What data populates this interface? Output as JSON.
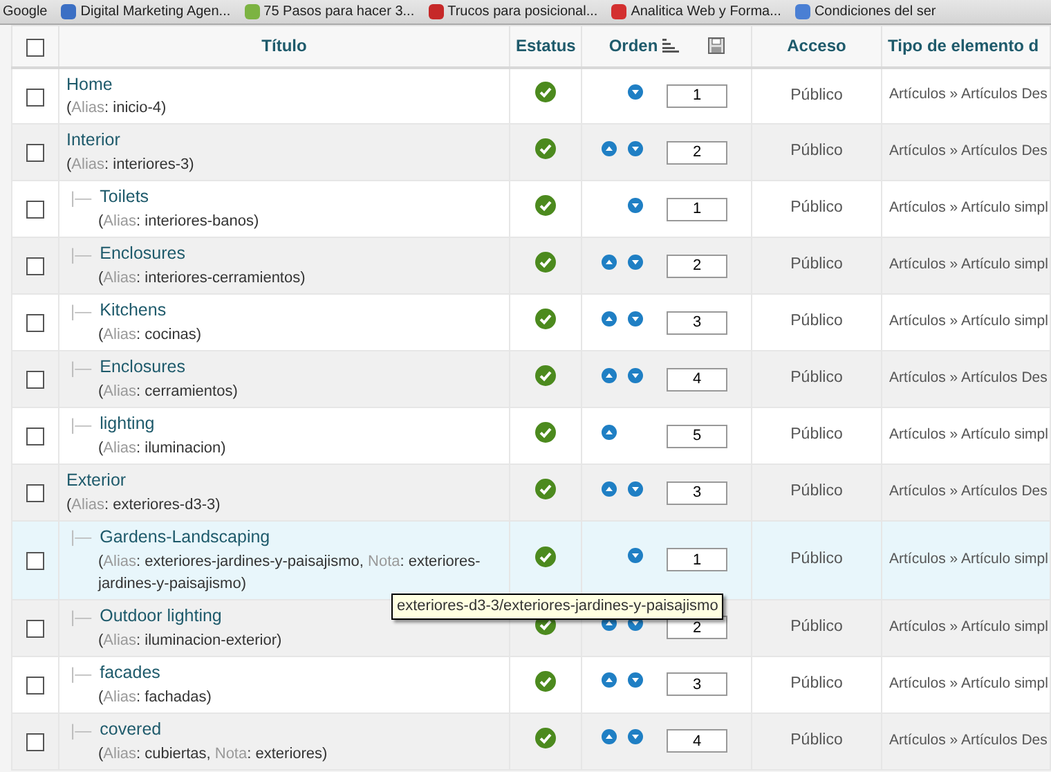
{
  "bookmarks": [
    {
      "label": "Google"
    },
    {
      "label": "Digital Marketing Agen...",
      "color": "#3b6fc4"
    },
    {
      "label": "75 Pasos para hacer 3...",
      "color": "#7cb342"
    },
    {
      "label": "Trucos para posicional...",
      "color": "#c62828"
    },
    {
      "label": "Analitica Web y Forma...",
      "color": "#d32f2f"
    },
    {
      "label": "Condiciones del ser",
      "color": "#4a7fd4"
    }
  ],
  "table": {
    "columns": [
      "Título",
      "Estatus",
      "Orden",
      "Acceso",
      "Tipo de elemento d"
    ],
    "select_all_checked": false,
    "rows": [
      {
        "title": "Home",
        "alias_parts": [
          {
            "text": "(",
            "muted": false
          },
          {
            "text": "Alias",
            "muted": true
          },
          {
            "text": ": inicio-4)",
            "muted": false
          }
        ],
        "checked": false,
        "hovered": false,
        "published": true,
        "can_move_up": false,
        "can_move_down": true,
        "order": "1",
        "access": "Público",
        "type": "Artículos » Artículos Des",
        "children": []
      },
      {
        "title": "Interior",
        "alias_parts": [
          {
            "text": "(",
            "muted": false
          },
          {
            "text": "Alias",
            "muted": true
          },
          {
            "text": ": interiores-3)",
            "muted": false
          }
        ],
        "checked": false,
        "hovered": false,
        "published": true,
        "can_move_up": true,
        "can_move_down": true,
        "order": "2",
        "access": "Público",
        "type": "Artículos » Artículos Des",
        "children": [
          {
            "marker": "|—",
            "title": "Toilets",
            "alias_parts": [
              {
                "text": "(",
                "muted": false
              },
              {
                "text": "Alias",
                "muted": true
              },
              {
                "text": ": interiores-banos)",
                "muted": false
              }
            ],
            "checked": false,
            "hovered": false,
            "published": true,
            "can_move_up": false,
            "can_move_down": true,
            "order": "1",
            "access": "Público",
            "type": "Artículos » Artículo simpl"
          },
          {
            "marker": "|—",
            "title": "Enclosures",
            "alias_parts": [
              {
                "text": "(",
                "muted": false
              },
              {
                "text": "Alias",
                "muted": true
              },
              {
                "text": ": interiores-cerramientos)",
                "muted": false
              }
            ],
            "checked": false,
            "hovered": false,
            "published": true,
            "can_move_up": true,
            "can_move_down": true,
            "order": "2",
            "access": "Público",
            "type": "Artículos » Artículo simpl"
          },
          {
            "marker": "|—",
            "title": "Kitchens",
            "alias_parts": [
              {
                "text": "(",
                "muted": false
              },
              {
                "text": "Alias",
                "muted": true
              },
              {
                "text": ": cocinas)",
                "muted": false
              }
            ],
            "checked": false,
            "hovered": false,
            "published": true,
            "can_move_up": true,
            "can_move_down": true,
            "order": "3",
            "access": "Público",
            "type": "Artículos » Artículo simpl"
          },
          {
            "marker": "|—",
            "title": "Enclosures",
            "alias_parts": [
              {
                "text": "(",
                "muted": false
              },
              {
                "text": "Alias",
                "muted": true
              },
              {
                "text": ": cerramientos)",
                "muted": false
              }
            ],
            "checked": false,
            "hovered": false,
            "published": true,
            "can_move_up": true,
            "can_move_down": true,
            "order": "4",
            "access": "Público",
            "type": "Artículos » Artículos Des"
          },
          {
            "marker": "|—",
            "title": "lighting",
            "alias_parts": [
              {
                "text": "(",
                "muted": false
              },
              {
                "text": "Alias",
                "muted": true
              },
              {
                "text": ": iluminacion)",
                "muted": false
              }
            ],
            "checked": false,
            "hovered": false,
            "published": true,
            "can_move_up": true,
            "can_move_down": false,
            "order": "5",
            "access": "Público",
            "type": "Artículos » Artículo simpl"
          }
        ]
      },
      {
        "title": "Exterior",
        "alias_parts": [
          {
            "text": "(",
            "muted": false
          },
          {
            "text": "Alias",
            "muted": true
          },
          {
            "text": ": exteriores-d3-3)",
            "muted": false
          }
        ],
        "checked": false,
        "hovered": false,
        "published": true,
        "can_move_up": true,
        "can_move_down": true,
        "order": "3",
        "access": "Público",
        "type": "Artículos » Artículos Des",
        "children": [
          {
            "marker": "|—",
            "title": "Gardens-Landscaping",
            "alias_parts": [
              {
                "text": "(",
                "muted": false
              },
              {
                "text": "Alias",
                "muted": true
              },
              {
                "text": ": exteriores-jardines-y-paisajismo, ",
                "muted": false
              },
              {
                "text": "Nota",
                "muted": true
              },
              {
                "text": ": exteriores-jardines-y-paisajismo)",
                "muted": false
              }
            ],
            "checked": false,
            "hovered": true,
            "published": true,
            "can_move_up": false,
            "can_move_down": true,
            "order": "1",
            "access": "Público",
            "type": "Artículos » Artículo simpl"
          },
          {
            "marker": "|—",
            "title": "Outdoor lighting",
            "alias_parts": [
              {
                "text": "(",
                "muted": false
              },
              {
                "text": "Alias",
                "muted": true
              },
              {
                "text": ": iluminacion-exterior)",
                "muted": false
              }
            ],
            "checked": false,
            "hovered": false,
            "published": true,
            "can_move_up": true,
            "can_move_down": true,
            "order": "2",
            "access": "Público",
            "type": "Artículos » Artículo simpl"
          },
          {
            "marker": "|—",
            "title": "facades",
            "alias_parts": [
              {
                "text": "(",
                "muted": false
              },
              {
                "text": "Alias",
                "muted": true
              },
              {
                "text": ": fachadas)",
                "muted": false
              }
            ],
            "checked": false,
            "hovered": false,
            "published": true,
            "can_move_up": true,
            "can_move_down": true,
            "order": "3",
            "access": "Público",
            "type": "Artículos » Artículo simpl"
          },
          {
            "marker": "|—",
            "title": "covered",
            "alias_parts": [
              {
                "text": "(",
                "muted": false
              },
              {
                "text": "Alias",
                "muted": true
              },
              {
                "text": ": cubiertas, ",
                "muted": false
              },
              {
                "text": "Nota",
                "muted": true
              },
              {
                "text": ": exteriores)",
                "muted": false
              }
            ],
            "checked": false,
            "hovered": false,
            "published": true,
            "can_move_up": true,
            "can_move_down": true,
            "order": "4",
            "access": "Público",
            "type": "Artículos » Artículos Des"
          }
        ]
      }
    ]
  },
  "tooltip": {
    "text": "exteriores-d3-3/exteriores-jardines-y-paisajismo"
  }
}
